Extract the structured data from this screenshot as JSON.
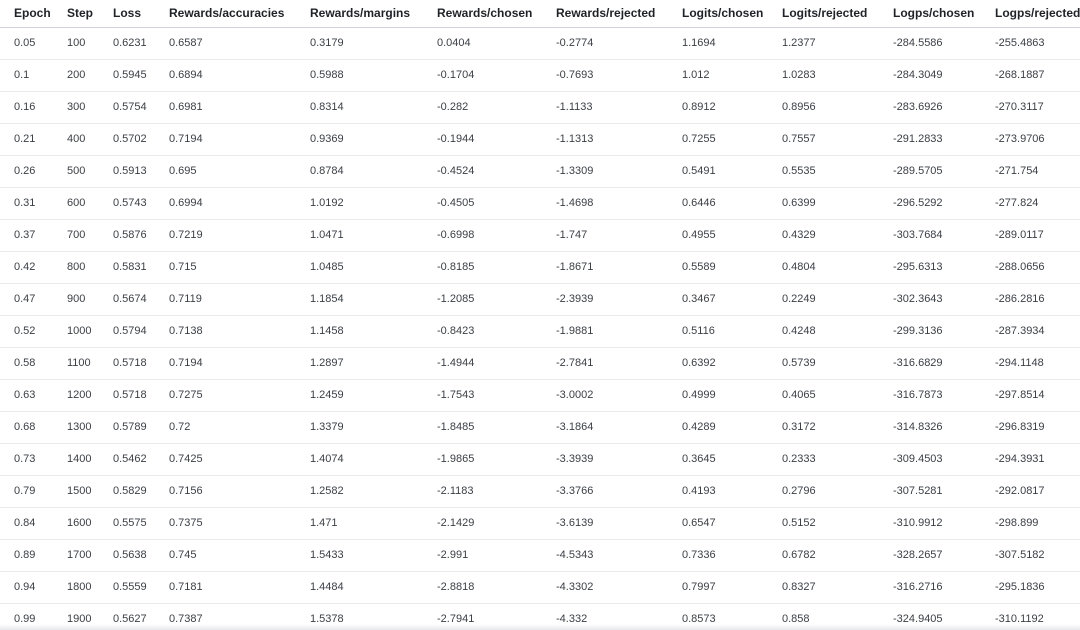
{
  "table": {
    "headers": [
      "Epoch",
      "Step",
      "Loss",
      "Rewards/accuracies",
      "Rewards/margins",
      "Rewards/chosen",
      "Rewards/rejected",
      "Logits/chosen",
      "Logits/rejected",
      "Logps/chosen",
      "Logps/rejected"
    ],
    "rows": [
      [
        "0.05",
        "100",
        "0.6231",
        "0.6587",
        "0.3179",
        "0.0404",
        "-0.2774",
        "1.1694",
        "1.2377",
        "-284.5586",
        "-255.4863"
      ],
      [
        "0.1",
        "200",
        "0.5945",
        "0.6894",
        "0.5988",
        "-0.1704",
        "-0.7693",
        "1.012",
        "1.0283",
        "-284.3049",
        "-268.1887"
      ],
      [
        "0.16",
        "300",
        "0.5754",
        "0.6981",
        "0.8314",
        "-0.282",
        "-1.1133",
        "0.8912",
        "0.8956",
        "-283.6926",
        "-270.3117"
      ],
      [
        "0.21",
        "400",
        "0.5702",
        "0.7194",
        "0.9369",
        "-0.1944",
        "-1.1313",
        "0.7255",
        "0.7557",
        "-291.2833",
        "-273.9706"
      ],
      [
        "0.26",
        "500",
        "0.5913",
        "0.695",
        "0.8784",
        "-0.4524",
        "-1.3309",
        "0.5491",
        "0.5535",
        "-289.5705",
        "-271.754"
      ],
      [
        "0.31",
        "600",
        "0.5743",
        "0.6994",
        "1.0192",
        "-0.4505",
        "-1.4698",
        "0.6446",
        "0.6399",
        "-296.5292",
        "-277.824"
      ],
      [
        "0.37",
        "700",
        "0.5876",
        "0.7219",
        "1.0471",
        "-0.6998",
        "-1.747",
        "0.4955",
        "0.4329",
        "-303.7684",
        "-289.0117"
      ],
      [
        "0.42",
        "800",
        "0.5831",
        "0.715",
        "1.0485",
        "-0.8185",
        "-1.8671",
        "0.5589",
        "0.4804",
        "-295.6313",
        "-288.0656"
      ],
      [
        "0.47",
        "900",
        "0.5674",
        "0.7119",
        "1.1854",
        "-1.2085",
        "-2.3939",
        "0.3467",
        "0.2249",
        "-302.3643",
        "-286.2816"
      ],
      [
        "0.52",
        "1000",
        "0.5794",
        "0.7138",
        "1.1458",
        "-0.8423",
        "-1.9881",
        "0.5116",
        "0.4248",
        "-299.3136",
        "-287.3934"
      ],
      [
        "0.58",
        "1100",
        "0.5718",
        "0.7194",
        "1.2897",
        "-1.4944",
        "-2.7841",
        "0.6392",
        "0.5739",
        "-316.6829",
        "-294.1148"
      ],
      [
        "0.63",
        "1200",
        "0.5718",
        "0.7275",
        "1.2459",
        "-1.7543",
        "-3.0002",
        "0.4999",
        "0.4065",
        "-316.7873",
        "-297.8514"
      ],
      [
        "0.68",
        "1300",
        "0.5789",
        "0.72",
        "1.3379",
        "-1.8485",
        "-3.1864",
        "0.4289",
        "0.3172",
        "-314.8326",
        "-296.8319"
      ],
      [
        "0.73",
        "1400",
        "0.5462",
        "0.7425",
        "1.4074",
        "-1.9865",
        "-3.3939",
        "0.3645",
        "0.2333",
        "-309.4503",
        "-294.3931"
      ],
      [
        "0.79",
        "1500",
        "0.5829",
        "0.7156",
        "1.2582",
        "-2.1183",
        "-3.3766",
        "0.4193",
        "0.2796",
        "-307.5281",
        "-292.0817"
      ],
      [
        "0.84",
        "1600",
        "0.5575",
        "0.7375",
        "1.471",
        "-2.1429",
        "-3.6139",
        "0.6547",
        "0.5152",
        "-310.9912",
        "-298.899"
      ],
      [
        "0.89",
        "1700",
        "0.5638",
        "0.745",
        "1.5433",
        "-2.991",
        "-4.5343",
        "0.7336",
        "0.6782",
        "-328.2657",
        "-307.5182"
      ],
      [
        "0.94",
        "1800",
        "0.5559",
        "0.7181",
        "1.4484",
        "-2.8818",
        "-4.3302",
        "0.7997",
        "0.8327",
        "-316.2716",
        "-295.1836"
      ],
      [
        "0.99",
        "1900",
        "0.5627",
        "0.7387",
        "1.5378",
        "-2.7941",
        "-4.332",
        "0.8573",
        "0.858",
        "-324.9405",
        "-310.1192"
      ]
    ]
  }
}
